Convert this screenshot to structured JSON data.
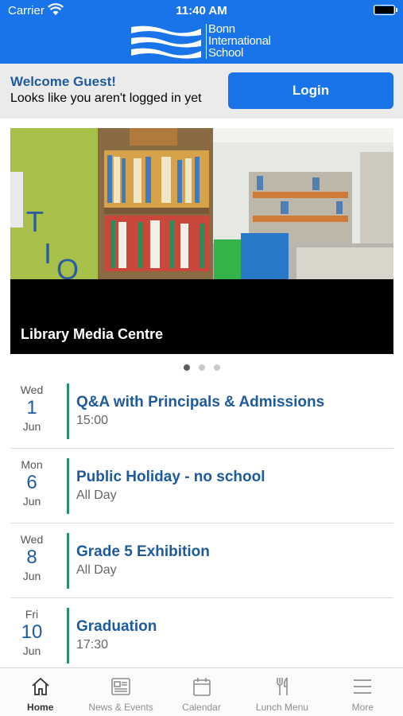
{
  "status": {
    "carrier": "Carrier",
    "time": "11:40 AM"
  },
  "logo": {
    "line1": "Bonn",
    "line2": "International",
    "line3": "School"
  },
  "welcome": {
    "title": "Welcome Guest!",
    "subtitle": "Looks like you aren't logged in yet",
    "login_label": "Login"
  },
  "carousel": {
    "caption": "Library Media Centre",
    "slide_count": 3,
    "active_index": 0
  },
  "events": [
    {
      "dow": "Wed",
      "day": "1",
      "month": "Jun",
      "title": "Q&A with Principals & Admissions",
      "time": "15:00"
    },
    {
      "dow": "Mon",
      "day": "6",
      "month": "Jun",
      "title": "Public Holiday - no school",
      "time": "All Day"
    },
    {
      "dow": "Wed",
      "day": "8",
      "month": "Jun",
      "title": "Grade 5 Exhibition",
      "time": "All Day"
    },
    {
      "dow": "Fri",
      "day": "10",
      "month": "Jun",
      "title": "Graduation",
      "time": "17:30"
    }
  ],
  "tabs": [
    {
      "label": "Home",
      "icon": "home-icon",
      "active": true
    },
    {
      "label": "News & Events",
      "icon": "newspaper-icon",
      "active": false
    },
    {
      "label": "Calendar",
      "icon": "calendar-icon",
      "active": false
    },
    {
      "label": "Lunch Menu",
      "icon": "cutlery-icon",
      "active": false
    },
    {
      "label": "More",
      "icon": "menu-icon",
      "active": false
    }
  ],
  "colors": {
    "brand": "#1874e8",
    "title_blue": "#1e5a9e",
    "accent_green": "#2e8b6e"
  }
}
